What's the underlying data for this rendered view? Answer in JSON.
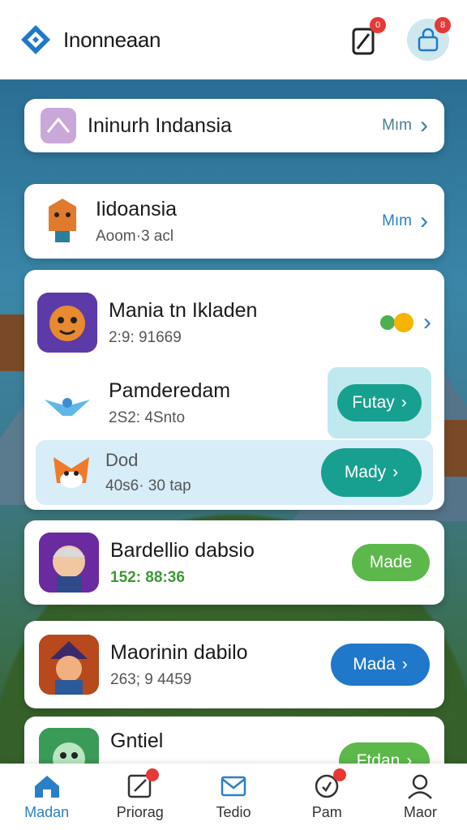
{
  "header": {
    "title": "Inonneaan",
    "icons": [
      "logo-icon",
      "clipboard-icon",
      "profile-lock-icon"
    ],
    "badge_1": "0",
    "badge_2": "8"
  },
  "cards": {
    "top": {
      "title": "Ininurh Indansia",
      "more": "Mım"
    },
    "second": {
      "title": "Iidoansia",
      "subtitle": "Aoom·3 acl",
      "more": "Mım"
    }
  },
  "group": {
    "row1": {
      "title": "Mania tn Ikladen",
      "subtitle": "2:9: 91669"
    },
    "row2": {
      "title": "Pamderedam",
      "subtitle": "2S2: 4Snto",
      "button": "Futay"
    },
    "row3": {
      "title": "Dod",
      "subtitle": "40s6· 30 tap",
      "button": "Mady"
    }
  },
  "list": [
    {
      "title": "Bardellio dabsio",
      "subtitle": "152: 88:36",
      "button": "Made",
      "color": "#5cb84a"
    },
    {
      "title": "Maorinin dabilo",
      "subtitle": "263; 9 4459",
      "button": "Mada",
      "color": "#1f78c9"
    },
    {
      "title": "Gntiel",
      "subtitle": "",
      "button": "Ftdan",
      "color": "#5cb84a"
    }
  ],
  "nav": [
    {
      "label": "Madan",
      "icon": "home-icon",
      "active": true
    },
    {
      "label": "Priorag",
      "icon": "edit-icon",
      "active": false
    },
    {
      "label": "Tedio",
      "icon": "mail-icon",
      "active": false
    },
    {
      "label": "Pam",
      "icon": "clock-icon",
      "active": false
    },
    {
      "label": "Maor",
      "icon": "user-icon",
      "active": false
    }
  ],
  "colors": {
    "accent": "#2a7fc7",
    "teal": "#17a08f",
    "green": "#5cb84a",
    "blue": "#1f78c9",
    "badge": "#e53935"
  }
}
